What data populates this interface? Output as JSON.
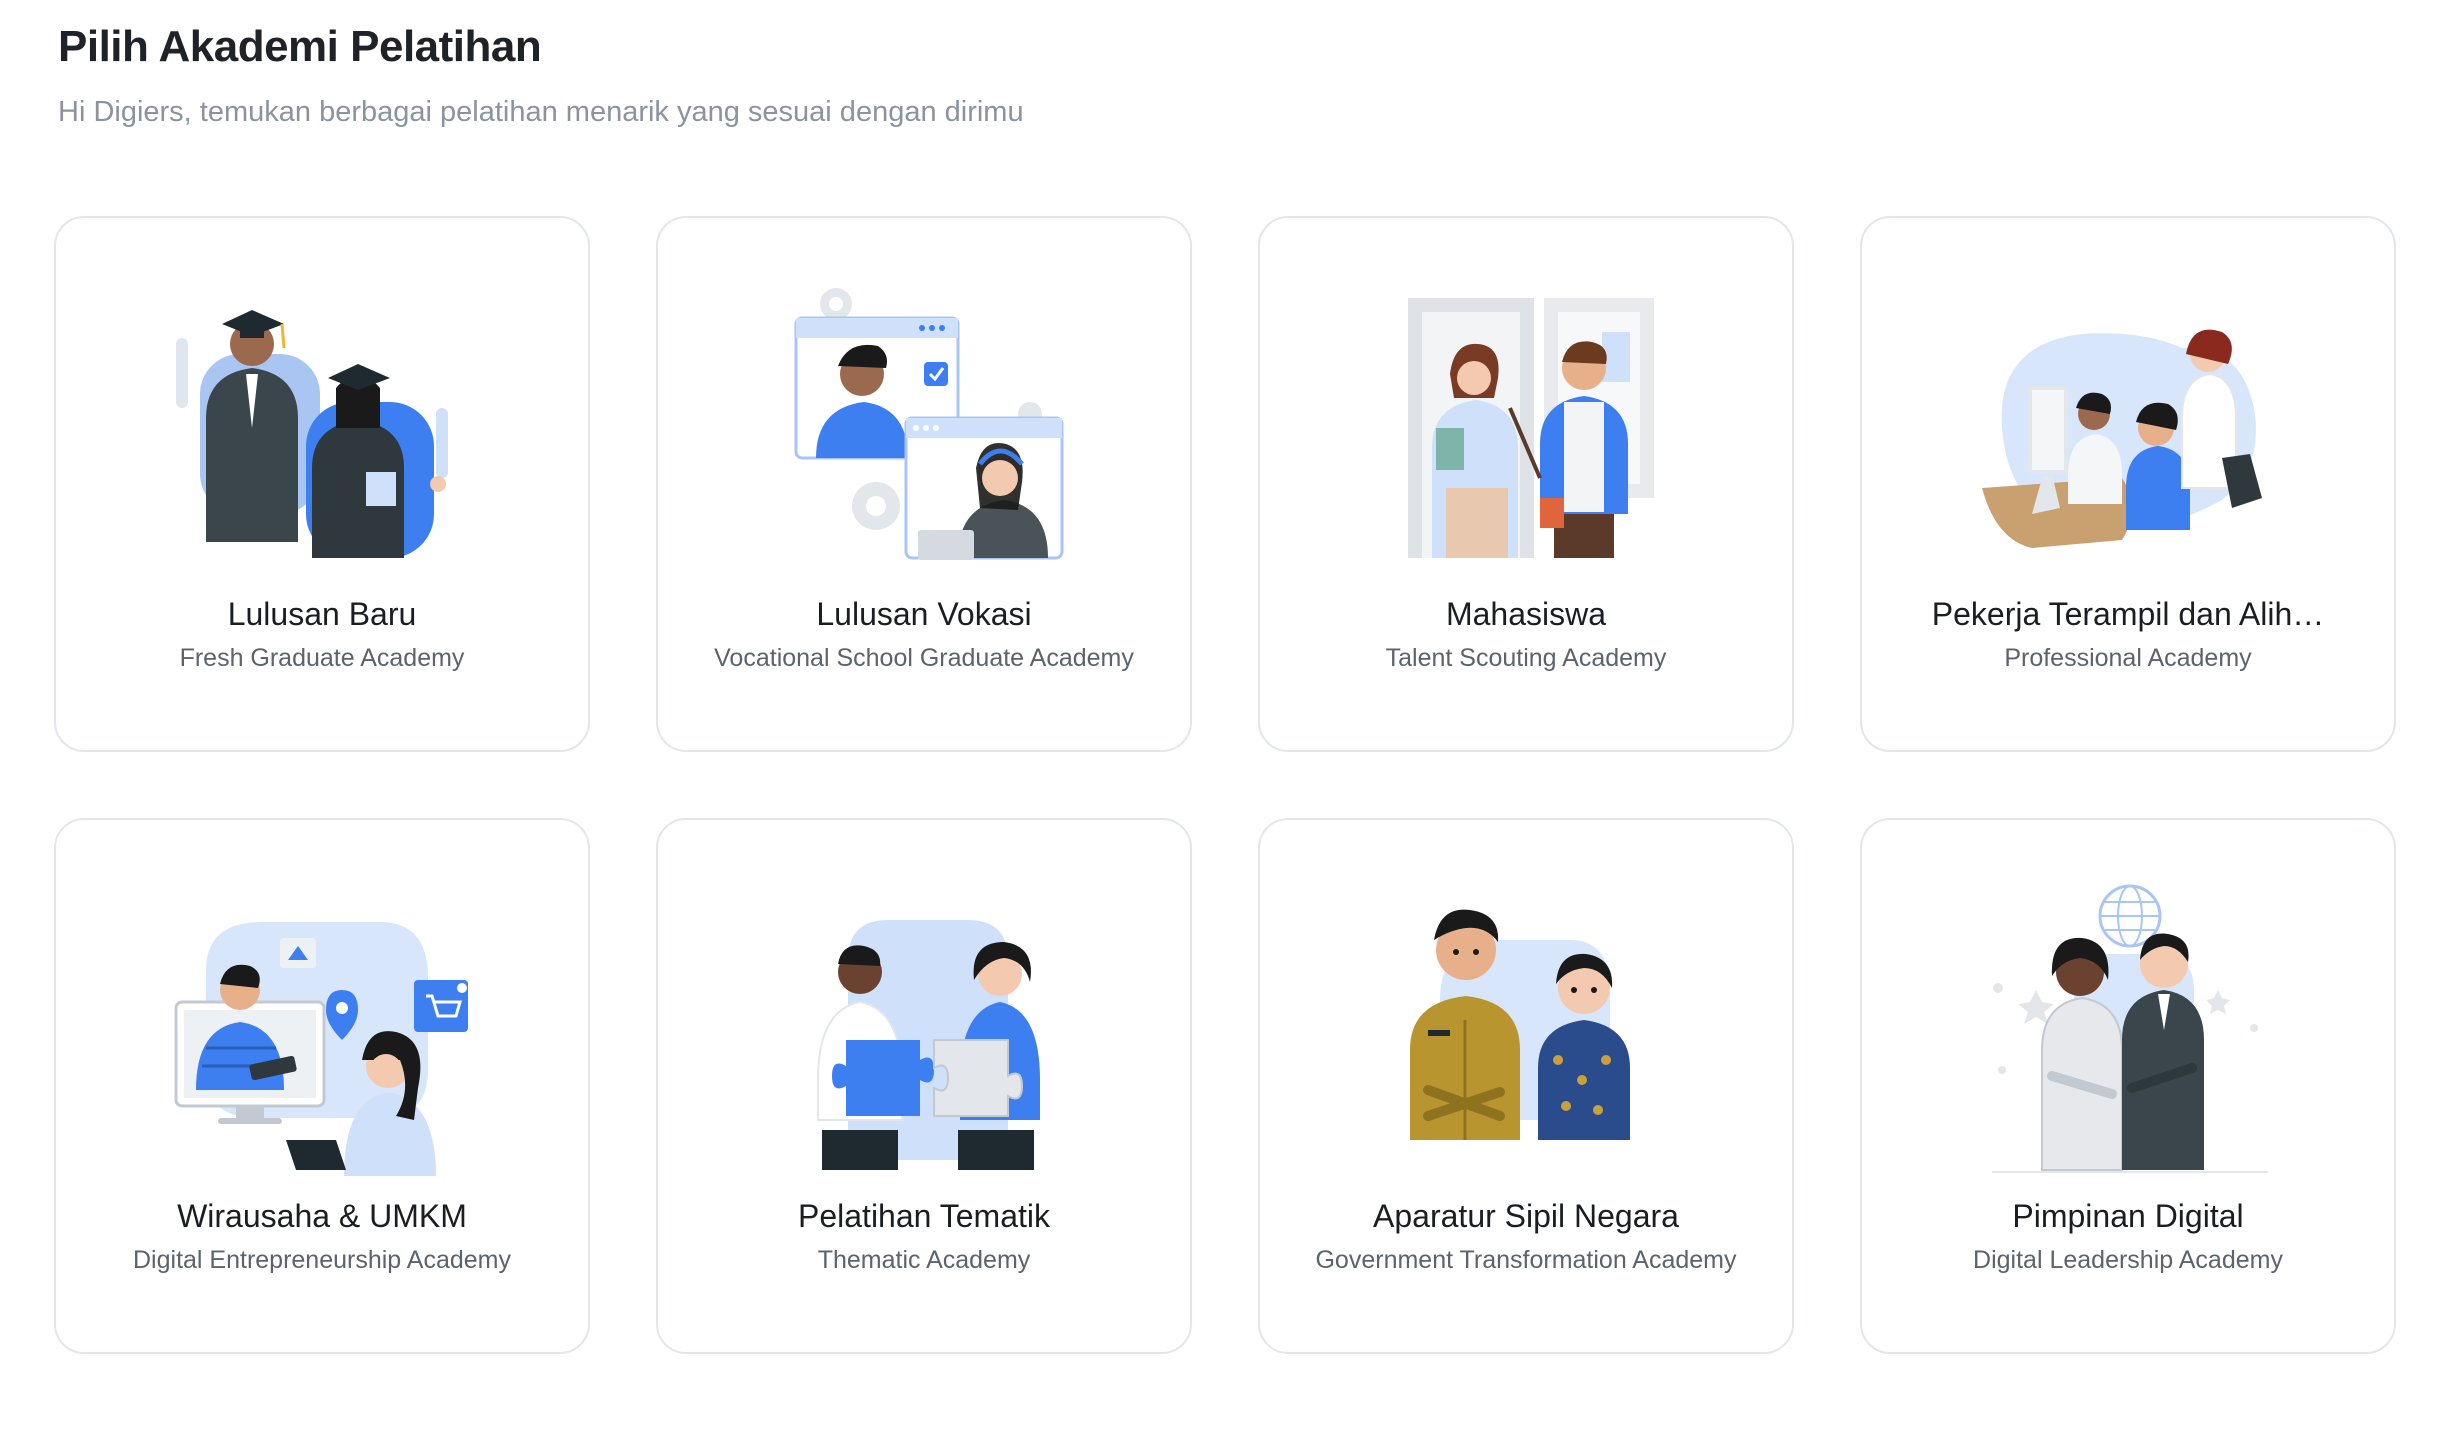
{
  "header": {
    "title": "Pilih Akademi Pelatihan",
    "subtitle": "Hi Digiers, temukan berbagai pelatihan menarik yang sesuai dengan dirimu"
  },
  "colors": {
    "accent_blue": "#3d7ef0",
    "light_blue": "#cfe0fb",
    "dark_slate": "#3b464c",
    "card_border": "#e3e6ea"
  },
  "academies": [
    {
      "title": "Lulusan Baru",
      "subtitle": "Fresh Graduate Academy",
      "illustration": "graduates-illustration"
    },
    {
      "title": "Lulusan Vokasi",
      "subtitle": "Vocational School Graduate Academy",
      "illustration": "video-call-illustration"
    },
    {
      "title": "Mahasiswa",
      "subtitle": "Talent Scouting Academy",
      "illustration": "students-illustration"
    },
    {
      "title": "Pekerja Terampil dan Alih…",
      "subtitle": "Professional Academy",
      "illustration": "office-workers-illustration"
    },
    {
      "title": "Wirausaha & UMKM",
      "subtitle": "Digital Entrepreneurship Academy",
      "illustration": "online-shop-illustration"
    },
    {
      "title": "Pelatihan Tematik",
      "subtitle": "Thematic Academy",
      "illustration": "puzzle-illustration"
    },
    {
      "title": "Aparatur Sipil Negara",
      "subtitle": "Government Transformation Academy",
      "illustration": "civil-servants-illustration"
    },
    {
      "title": "Pimpinan Digital",
      "subtitle": "Digital Leadership Academy",
      "illustration": "leaders-illustration"
    }
  ]
}
